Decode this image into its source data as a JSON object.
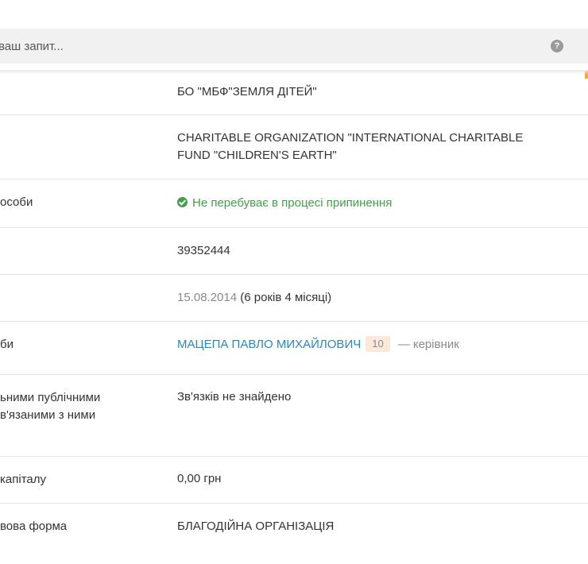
{
  "search": {
    "placeholder": "ваш запит...",
    "help_icon": "?"
  },
  "rows": [
    {
      "label": "",
      "value": "БО \"МБФ\"ЗЕМЛЯ ДІТЕЙ\""
    },
    {
      "label": "",
      "value": "CHARITABLE ORGANIZATION \"INTERNATIONAL CHARITABLE FUND \"CHILDREN'S EARTH\""
    },
    {
      "label": "особи",
      "value": "Не перебуває в процесі припинення"
    },
    {
      "label": "",
      "value": "39352444"
    },
    {
      "label": "",
      "date": "15.08.2014",
      "value": "(6 років 4 місяці)"
    },
    {
      "label": "би",
      "person": "МАЦЕПА ПАВЛО МИХАЙЛОВИЧ",
      "badge": "10",
      "role": "— керівник"
    },
    {
      "label_line1": "ьними публічними",
      "label_line2": "в'язаними з ними",
      "value": "Зв'язків не знайдено"
    },
    {
      "label": "капіталу",
      "value": "0,00 грн"
    },
    {
      "label": "вова форма",
      "value": "БЛАГОДІЙНА ОРГАНІЗАЦІЯ"
    }
  ],
  "colors": {
    "status_ok": "#43a047",
    "link": "#2a85c8",
    "badge_bg": "#fbe9dc"
  }
}
